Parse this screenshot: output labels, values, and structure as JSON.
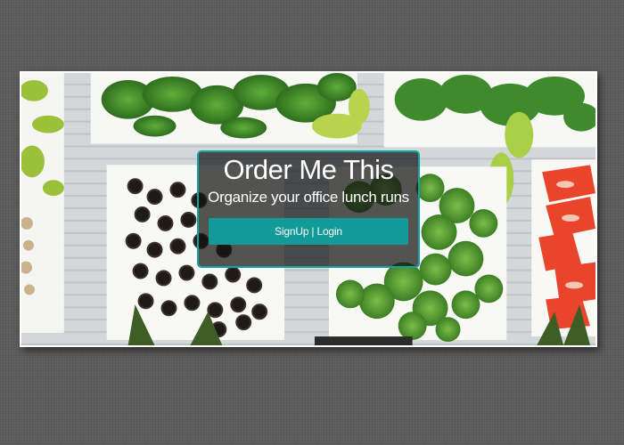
{
  "hero": {
    "title": "Order Me This",
    "subtitle": "Organize your office lunch runs",
    "signup_login_label": "SignUp | Login"
  },
  "colors": {
    "page_background": "#5c5c5c",
    "accent": "#129a99",
    "card_border": "#13a3a0",
    "card_background": "rgba(20,20,20,0.72)",
    "frame_border": "#ffffff"
  }
}
